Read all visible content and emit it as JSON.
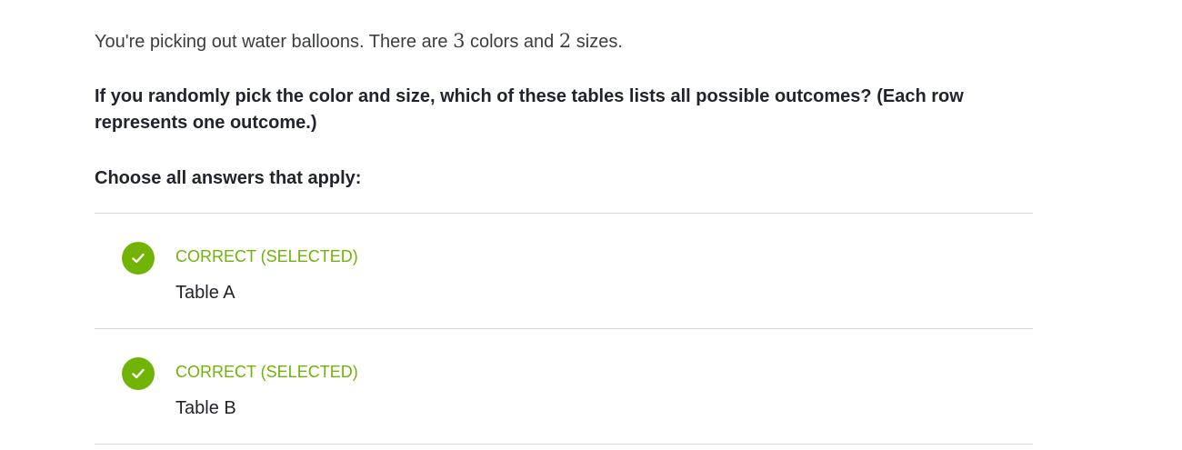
{
  "question": {
    "intro_before": "You're picking out water balloons. There are ",
    "num_colors": "3",
    "intro_middle": " colors and ",
    "num_sizes": "2",
    "intro_after": " sizes.",
    "prompt": "If you randomly pick the color and size, which of these tables lists all possible outcomes? (Each row represents one outcome.)",
    "instruction": "Choose all answers that apply:"
  },
  "choices": [
    {
      "status": "CORRECT (SELECTED)",
      "label": "Table A",
      "icon": "checkmark-icon",
      "selected": true,
      "correct": true
    },
    {
      "status": "CORRECT (SELECTED)",
      "label": "Table B",
      "icon": "checkmark-icon",
      "selected": true,
      "correct": true
    }
  ],
  "colors": {
    "correct_green": "#71b307",
    "divider": "#d6d8da",
    "text": "#21242c"
  }
}
